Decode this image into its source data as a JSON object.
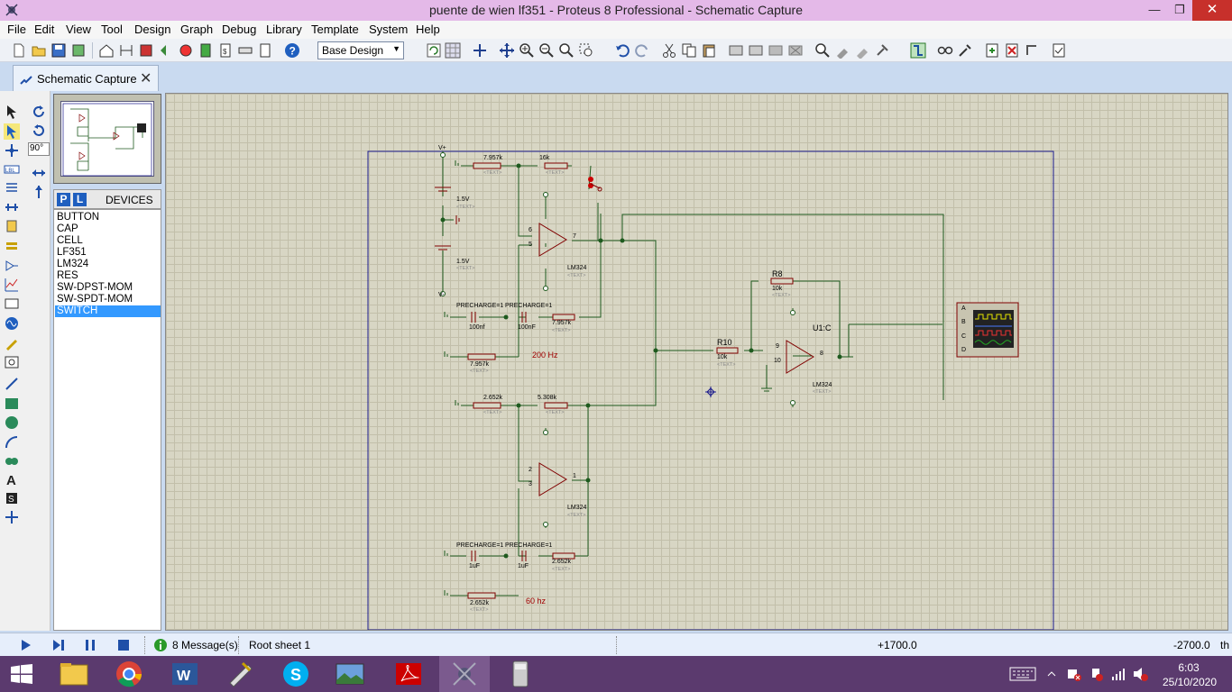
{
  "window": {
    "title": "puente de wien lf351 - Proteus 8 Professional - Schematic Capture",
    "minimize_glyph": "—",
    "maximize_glyph": "❐",
    "close_glyph": "✕"
  },
  "menu": {
    "items": [
      "File",
      "Edit",
      "View",
      "Tool",
      "Design",
      "Graph",
      "Debug",
      "Library",
      "Template",
      "System",
      "Help"
    ]
  },
  "toolbar": {
    "design_selector": "Base Design"
  },
  "tab": {
    "label": "Schematic Capture",
    "close_glyph": "✕"
  },
  "left_panel": {
    "rotation_value": "90°",
    "p_button": "P",
    "l_button": "L",
    "devices_title": "DEVICES",
    "devices": [
      "BUTTON",
      "CAP",
      "CELL",
      "LF351",
      "LM324",
      "RES",
      "SW-DPST-MOM",
      "SW-SPDT-MOM",
      "SWITCH"
    ],
    "selected_device": "SWITCH"
  },
  "schematic": {
    "top_osc": {
      "r1": "7.957k",
      "r2": "16k",
      "cell1": "1.5V",
      "cell2": "1.5V",
      "vplus": "V+",
      "vminus": "V-",
      "c1_label": "PRECHARGE=1",
      "c1_value": "100nf",
      "c2_label": "PRECHARGE=1",
      "c2_value": "100nF",
      "r3": "7.957k",
      "r4": "7.957k",
      "opamp": "LM324",
      "pin6": "6",
      "pin5": "5",
      "pin7": "7",
      "freq": "200 Hz"
    },
    "bottom_osc": {
      "r1": "2.652k",
      "r2": "5.308k",
      "c1_label": "PRECHARGE=1",
      "c1_value": "1uF",
      "c2_label": "PRECHARGE=1",
      "c2_value": "1uF",
      "r3": "2.652k",
      "r4": "2.652k",
      "opamp": "LM324",
      "pin2": "2",
      "pin3": "3",
      "pin1": "1",
      "freq": "60 hz"
    },
    "summer": {
      "r10_ref": "R10",
      "r10_value": "10k",
      "r8_ref": "R8",
      "r8_value": "10k",
      "opamp_ref": "U1:C",
      "opamp": "LM324",
      "pin9": "9",
      "pin10": "10",
      "pin8": "8"
    },
    "scope_channels": [
      "A",
      "B",
      "C",
      "D"
    ],
    "text_placeholder": "<TEXT>"
  },
  "status": {
    "messages": "8 Message(s)",
    "sheet": "Root sheet 1",
    "coord_x": "+1700.0",
    "coord_y": "-2700.0",
    "unit": "th"
  },
  "taskbar": {
    "time": "6:03",
    "date": "25/10/2020"
  },
  "colors": {
    "canvas": "#d8d6c4",
    "wire": "#1e5a1e",
    "component_outline": "#800000",
    "sheet_border": "#1a1a8c",
    "title_bar": "#e4b9e8",
    "taskbar": "#5b3a6e"
  }
}
